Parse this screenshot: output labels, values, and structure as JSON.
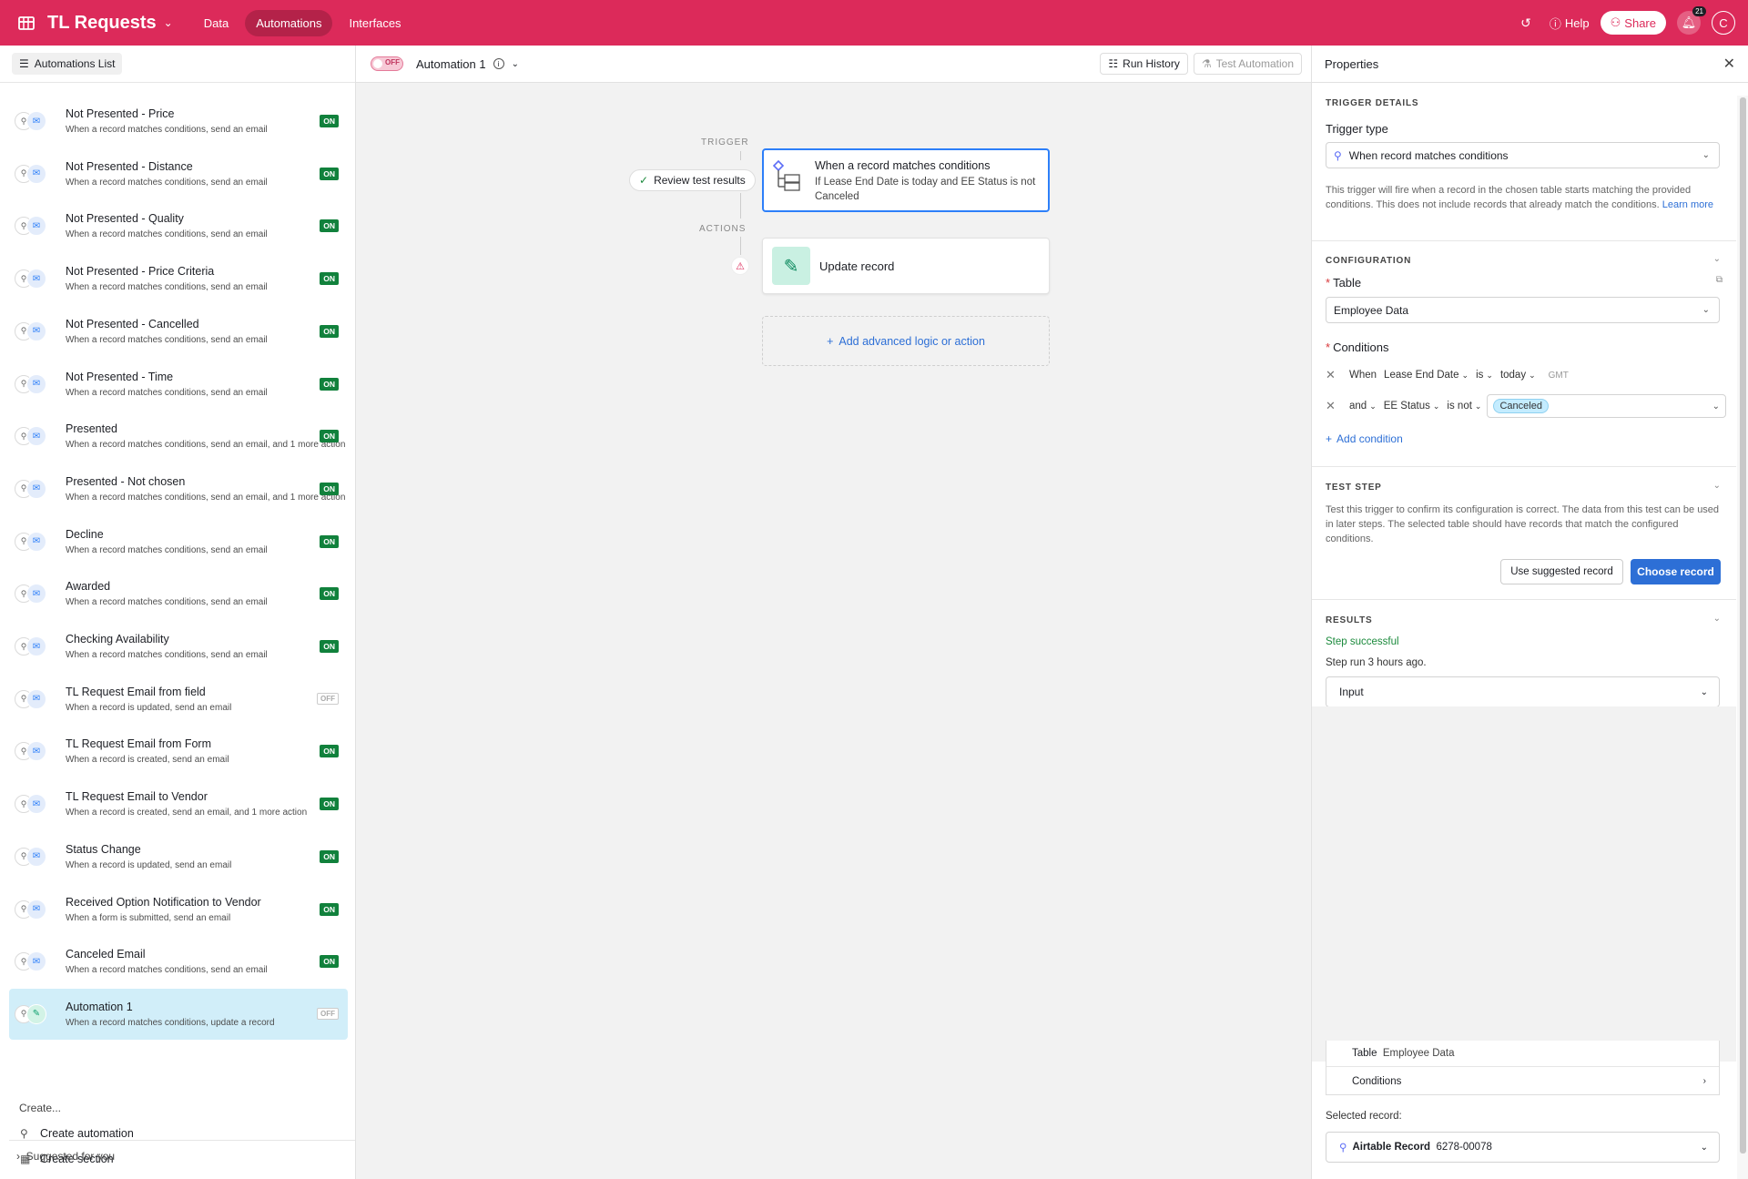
{
  "topbar": {
    "base_name": "TL Requests",
    "nav": [
      "Data",
      "Automations",
      "Interfaces"
    ],
    "help": "Help",
    "share": "Share",
    "notifications_count": "21",
    "avatar_initial": "C",
    "accent_color": "#dc2a5a"
  },
  "sidebar": {
    "header_button": "Automations List",
    "automations": [
      {
        "title": "Not Presented - Price",
        "subtitle": "When a record matches conditions, send an email",
        "status": "ON"
      },
      {
        "title": "Not Presented - Distance",
        "subtitle": "When a record matches conditions, send an email",
        "status": "ON"
      },
      {
        "title": "Not Presented - Quality",
        "subtitle": "When a record matches conditions, send an email",
        "status": "ON"
      },
      {
        "title": "Not Presented - Price Criteria",
        "subtitle": "When a record matches conditions, send an email",
        "status": "ON"
      },
      {
        "title": "Not Presented - Cancelled",
        "subtitle": "When a record matches conditions, send an email",
        "status": "ON"
      },
      {
        "title": "Not Presented - Time",
        "subtitle": "When a record matches conditions, send an email",
        "status": "ON"
      },
      {
        "title": "Presented",
        "subtitle": "When a record matches conditions, send an email, and 1 more action",
        "status": "ON"
      },
      {
        "title": "Presented - Not chosen",
        "subtitle": "When a record matches conditions, send an email, and 1 more action",
        "status": "ON"
      },
      {
        "title": "Decline",
        "subtitle": "When a record matches conditions, send an email",
        "status": "ON"
      },
      {
        "title": "Awarded",
        "subtitle": "When a record matches conditions, send an email",
        "status": "ON"
      },
      {
        "title": "Checking Availability",
        "subtitle": "When a record matches conditions, send an email",
        "status": "ON"
      },
      {
        "title": "TL Request Email from field",
        "subtitle": "When a record is updated, send an email",
        "status": "OFF"
      },
      {
        "title": "TL Request Email from Form",
        "subtitle": "When a record is created, send an email",
        "status": "ON"
      },
      {
        "title": "TL Request Email to Vendor",
        "subtitle": "When a record is created, send an email, and 1 more action",
        "status": "ON"
      },
      {
        "title": "Status Change",
        "subtitle": "When a record is updated, send an email",
        "status": "ON"
      },
      {
        "title": "Received Option Notification to Vendor",
        "subtitle": "When a form is submitted, send an email",
        "status": "ON"
      },
      {
        "title": "Canceled Email",
        "subtitle": "When a record matches conditions, send an email",
        "status": "ON"
      },
      {
        "title": "Automation 1",
        "subtitle": "When a record matches conditions, update a record",
        "status": "OFF"
      }
    ],
    "create_label": "Create...",
    "create_automation": "Create automation",
    "create_section": "Create section",
    "suggested": "Suggested for you"
  },
  "center": {
    "toggle_label": "OFF",
    "automation_name": "Automation 1",
    "run_history": "Run History",
    "test_automation": "Test Automation",
    "trigger_label": "TRIGGER",
    "actions_label": "ACTIONS",
    "review_pill": "Review test results",
    "trigger_title": "When a record matches conditions",
    "trigger_sub": "If Lease End Date is today and EE Status is not Canceled",
    "action_title": "Update record",
    "add_logic": "Add advanced logic or action"
  },
  "properties": {
    "title": "Properties",
    "trigger_details": "TRIGGER DETAILS",
    "trigger_type_label": "Trigger type",
    "trigger_type_value": "When record matches conditions",
    "trigger_desc": "This trigger will fire when a record in the chosen table starts matching the provided conditions. This does not include records that already match the conditions.",
    "learn_more": "Learn more",
    "configuration": "CONFIGURATION",
    "table_label": "Table",
    "table_value": "Employee Data",
    "conditions_label": "Conditions",
    "cond1": {
      "when": "When",
      "field": "Lease End Date",
      "op": "is",
      "value": "today",
      "tz": "GMT"
    },
    "cond2": {
      "when": "and",
      "field": "EE Status",
      "op": "is not",
      "value": "Canceled"
    },
    "add_condition": "Add condition",
    "test_step": "TEST STEP",
    "test_desc": "Test this trigger to confirm its configuration is correct. The data from this test can be used in later steps. The selected table should have records that match the configured conditions.",
    "use_suggested": "Use suggested record",
    "choose_record": "Choose record",
    "results": "RESULTS",
    "step_successful": "Step successful",
    "step_run": "Step run 3 hours ago.",
    "input_label": "Input",
    "table_row_label": "Table",
    "table_row_value": "Employee Data",
    "conditions_row": "Conditions",
    "selected_record_label": "Selected record:",
    "record_type": "Airtable Record",
    "record_id": "6278-00078"
  }
}
